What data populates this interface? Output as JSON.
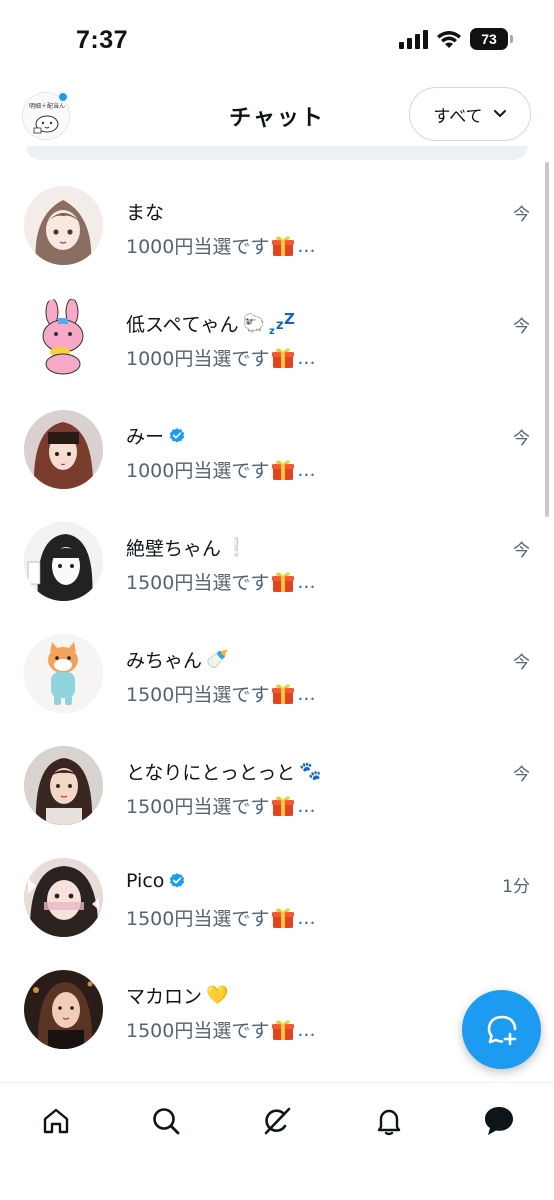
{
  "status_bar": {
    "time": "7:37",
    "battery": "73",
    "icons": [
      "cellular-signal-icon",
      "wifi-icon",
      "battery-icon"
    ]
  },
  "header": {
    "title": "チャット",
    "filter_label": "すべて",
    "avatar_text": "明細＋配当ん"
  },
  "chats": [
    {
      "name": "まな",
      "emoji": "",
      "verified": false,
      "preview": "1000円当選です",
      "ellipsis": "...",
      "time": "今",
      "avatar_color": "#c9b8b0"
    },
    {
      "name": "低スペてゃん",
      "emoji": "🐑",
      "verified": false,
      "preview": "1000円当選です",
      "ellipsis": "...",
      "time": "今",
      "avatar_color": "#f6c1d6"
    },
    {
      "name": "みー",
      "emoji": "",
      "verified": true,
      "preview": "1000円当選です",
      "ellipsis": "...",
      "time": "今",
      "avatar_color": "#8a5a4a"
    },
    {
      "name": "絶壁ちゃん",
      "emoji": "❕",
      "verified": false,
      "preview": "1500円当選です",
      "ellipsis": "...",
      "time": "今",
      "avatar_color": "#e6e6e6"
    },
    {
      "name": "みちゃん",
      "emoji": "🍼",
      "verified": false,
      "preview": "1500円当選です",
      "ellipsis": "...",
      "time": "今",
      "avatar_color": "#f4efe9"
    },
    {
      "name": "となりにとっとっと",
      "emoji": "🐾",
      "verified": false,
      "preview": "1500円当選です",
      "ellipsis": "...",
      "time": "今",
      "avatar_color": "#b9a7a0"
    },
    {
      "name": "Pico",
      "emoji": "",
      "verified": true,
      "preview": "1500円当選です",
      "ellipsis": "...",
      "time": "1分",
      "avatar_color": "#d8c9c4"
    },
    {
      "name": "マカロン",
      "emoji": "💛",
      "verified": false,
      "preview": "1500円当選です",
      "ellipsis": "...",
      "time": "",
      "avatar_color": "#3a2a22"
    }
  ],
  "nav": [
    "home-icon",
    "search-icon",
    "grok-icon",
    "notifications-icon",
    "messages-icon"
  ],
  "colors": {
    "accent": "#1d9bf0",
    "secondary_text": "#536471"
  }
}
